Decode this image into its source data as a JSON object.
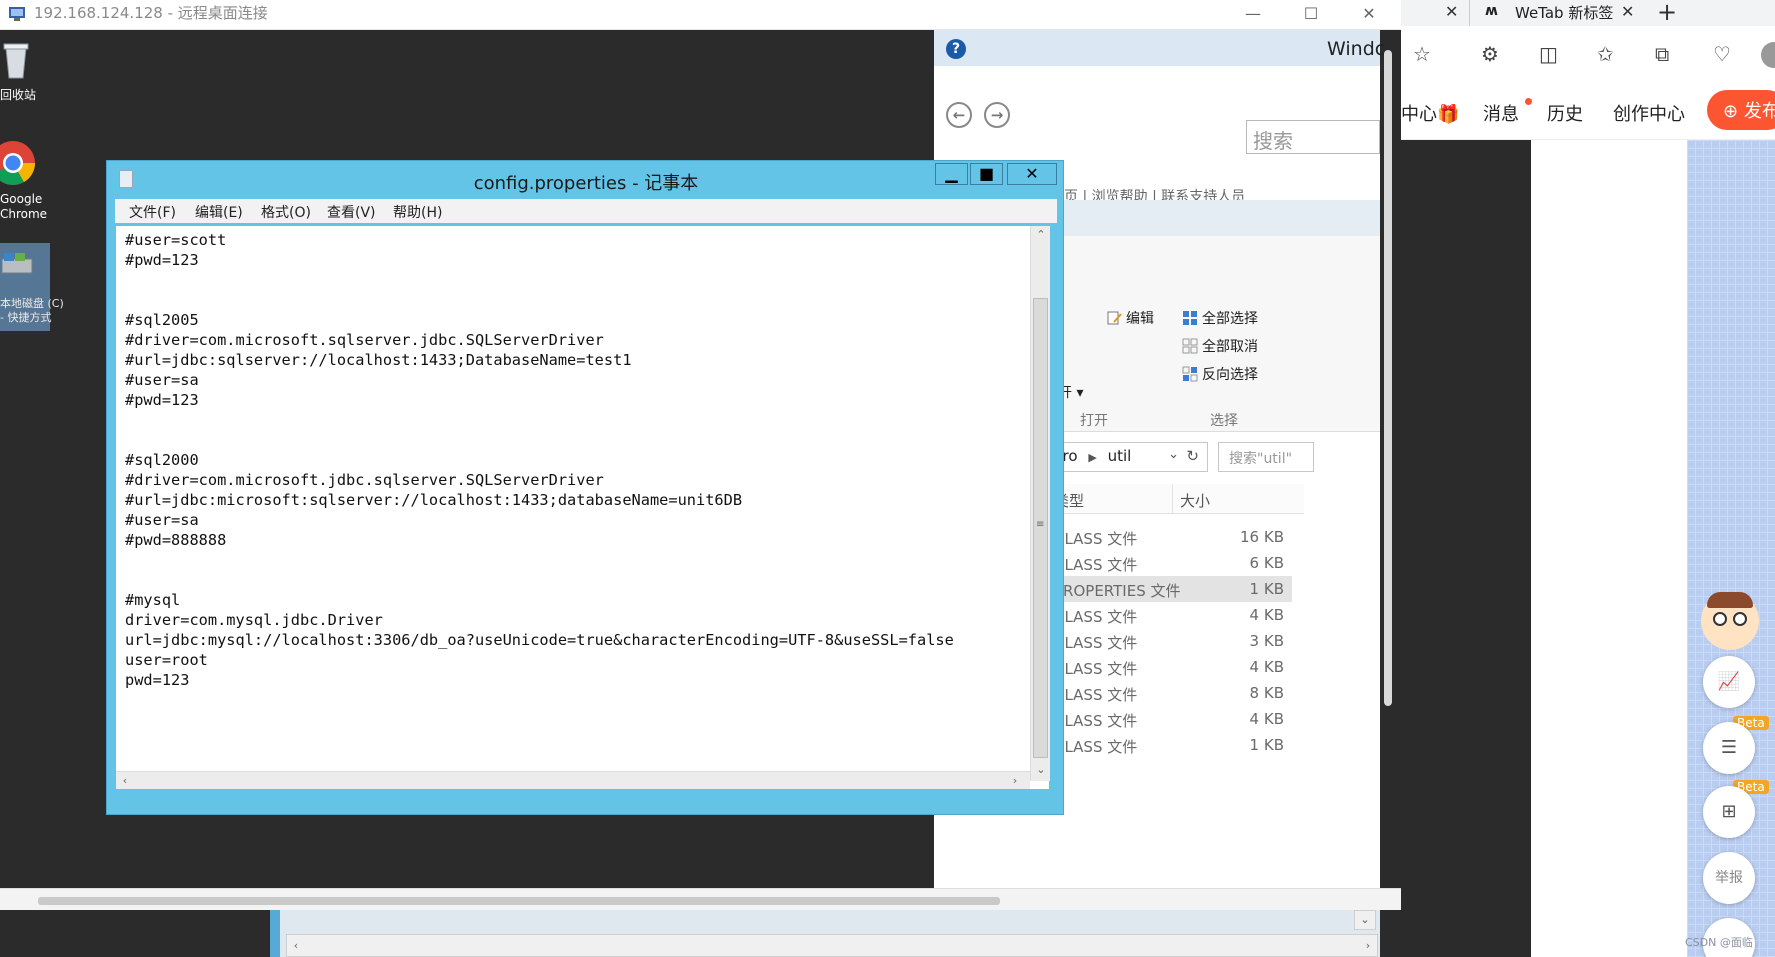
{
  "rdp": {
    "title": "192.168.124.128 - 远程桌面连接",
    "controls": [
      "—",
      "☐",
      "✕"
    ]
  },
  "desktop": {
    "icons": [
      {
        "name": "recycle-bin",
        "label": "回收站"
      },
      {
        "name": "chrome",
        "label_lines": [
          "Google",
          "Chrome"
        ]
      },
      {
        "name": "drive-c",
        "label_lines": [
          "本地磁盘 (C)",
          "- 快捷方式"
        ]
      }
    ]
  },
  "explorer": {
    "window_text": "Windc",
    "search_placeholder": "搜索",
    "links_text": "页 | 浏览帮助 | 联系支持人员",
    "ribbon": {
      "edit": "编辑",
      "open_dropdown": "打开",
      "select_all": "全部选择",
      "select_none": "全部取消",
      "invert_select": "反向选择",
      "group_open": "打开",
      "group_select": "选择"
    },
    "address": {
      "part1": "pro",
      "part2": "util"
    },
    "address_search": "搜索\"util\"",
    "columns": {
      "type": "类型",
      "size": "大小"
    },
    "files": [
      {
        "type": "CLASS 文件",
        "size": "16 KB"
      },
      {
        "type": "CLASS 文件",
        "size": "6 KB"
      },
      {
        "type": "PROPERTIES 文件",
        "size": "1 KB",
        "selected": true
      },
      {
        "type": "CLASS 文件",
        "size": "4 KB"
      },
      {
        "type": "CLASS 文件",
        "size": "3 KB"
      },
      {
        "type": "CLASS 文件",
        "size": "4 KB"
      },
      {
        "type": "CLASS 文件",
        "size": "8 KB"
      },
      {
        "type": "CLASS 文件",
        "size": "4 KB"
      },
      {
        "type": "CLASS 文件",
        "size": "1 KB"
      }
    ]
  },
  "notepad": {
    "title": "config.properties - 记事本",
    "menu": [
      "文件(F)",
      "编辑(E)",
      "格式(O)",
      "查看(V)",
      "帮助(H)"
    ],
    "content": "#user=scott\n#pwd=123\n\n\n#sql2005\n#driver=com.microsoft.sqlserver.jdbc.SQLServerDriver\n#url=jdbc:sqlserver://localhost:1433;DatabaseName=test1\n#user=sa\n#pwd=123\n\n\n#sql2000\n#driver=com.microsoft.jdbc.sqlserver.SQLServerDriver\n#url=jdbc:microsoft:sqlserver://localhost:1433;databaseName=unit6DB\n#user=sa\n#pwd=888888\n\n\n#mysql\ndriver=com.mysql.jdbc.Driver\nurl=jdbc:mysql://localhost:3306/db_oa?useUnicode=true&characterEncoding=UTF-8&useSSL=false\nuser=root\npwd=123"
  },
  "browser": {
    "tab_close": "✕",
    "tab_title": "WeTab 新标签",
    "new_tab": "+",
    "nav": [
      "中心",
      "消息",
      "历史",
      "创作中心"
    ],
    "publish": "发布",
    "float_labels": {
      "beta1": "Beta",
      "beta2": "Beta",
      "report": "举报"
    },
    "watermark": "CSDN @面临"
  },
  "colors": {
    "notepad_frame": "#63c4e8",
    "publish_bg": "#fc5531",
    "explorer_ribbon": "#f7f7f7"
  }
}
